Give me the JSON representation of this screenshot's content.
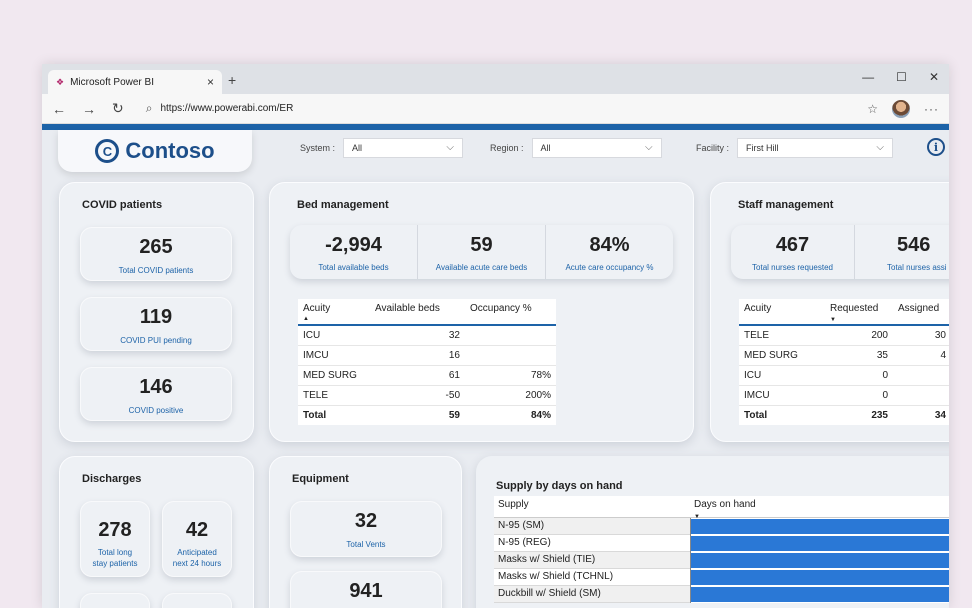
{
  "browser": {
    "tab_title": "Microsoft Power BI",
    "url_prefix": "https://www.",
    "url_bold": "powerabi.com",
    "url_suffix": "/ER"
  },
  "logo": {
    "letter": "C",
    "text": "Contoso"
  },
  "filters": [
    {
      "label": "System :",
      "value": "All"
    },
    {
      "label": "Region :",
      "value": "All"
    },
    {
      "label": "Facility :",
      "value": "First Hill"
    }
  ],
  "covid": {
    "title": "COVID patients",
    "kpis": [
      {
        "value": "265",
        "label": "Total COVID patients"
      },
      {
        "value": "119",
        "label": "COVID PUI pending"
      },
      {
        "value": "146",
        "label": "COVID positive"
      }
    ]
  },
  "bed": {
    "title": "Bed management",
    "kpis": [
      {
        "value": "-2,994",
        "label": "Total available beds"
      },
      {
        "value": "59",
        "label": "Available acute care beds"
      },
      {
        "value": "84%",
        "label": "Acute care occupancy %"
      }
    ],
    "table": {
      "headers": [
        "Acuity",
        "Available beds",
        "Occupancy %"
      ],
      "rows": [
        [
          "ICU",
          "32",
          ""
        ],
        [
          "IMCU",
          "16",
          ""
        ],
        [
          "MED SURG",
          "61",
          "78%"
        ],
        [
          "TELE",
          "-50",
          "200%"
        ]
      ],
      "total": [
        "Total",
        "59",
        "84%"
      ]
    }
  },
  "staff": {
    "title": "Staff management",
    "kpis": [
      {
        "value": "467",
        "label": "Total nurses requested"
      },
      {
        "value": "546",
        "label": "Total nurses assi"
      }
    ],
    "table": {
      "headers": [
        "Acuity",
        "Requested",
        "Assigned"
      ],
      "rows": [
        [
          "TELE",
          "200",
          "30"
        ],
        [
          "MED SURG",
          "35",
          "4"
        ],
        [
          "ICU",
          "0",
          ""
        ],
        [
          "IMCU",
          "0",
          ""
        ]
      ],
      "total": [
        "Total",
        "235",
        "34"
      ]
    }
  },
  "discharges": {
    "title": "Discharges",
    "kpis": [
      {
        "value": "278",
        "label1": "Total long",
        "label2": "stay patients"
      },
      {
        "value": "42",
        "label1": "Anticipated",
        "label2": "next 24 hours"
      }
    ]
  },
  "equipment": {
    "title": "Equipment",
    "kpis": [
      {
        "value": "32",
        "label": "Total Vents"
      },
      {
        "value": "941",
        "label": ""
      }
    ]
  },
  "supply": {
    "title": "Supply by days on hand",
    "col_supply": "Supply",
    "col_days": "Days on hand",
    "rows": [
      {
        "name": "N-95 (SM)"
      },
      {
        "name": "N-95 (REG)"
      },
      {
        "name": "Masks w/ Shield (TIE)"
      },
      {
        "name": "Masks w/ Shield (TCHNL)"
      },
      {
        "name": "Duckbill w/ Shield (SM)"
      }
    ]
  },
  "colors": {
    "accent": "#1d63a8",
    "bar": "#2a78d6",
    "brand": "#1d4f8a"
  }
}
